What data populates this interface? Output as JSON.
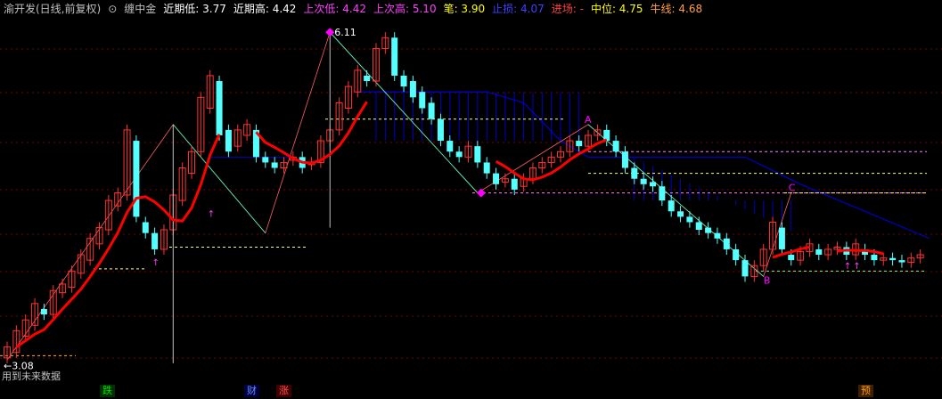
{
  "header": {
    "stock_title": "渝开发(日线,前复权)",
    "indicator_name": "缠中金",
    "recent_low": "近期低: 3.77",
    "recent_high": "近期高: 4.42",
    "prev_low": "上次低: 4.42",
    "prev_high": "上次高: 5.10",
    "stroke": "笔: 3.90",
    "stop_loss": "止损: 4.07",
    "entry": "进场: -",
    "midline": "中位: 4.75",
    "bull_line": "牛线: 4.68"
  },
  "colors": {
    "background": "#000000",
    "up_candle": "#ff3232",
    "down_candle": "#54ffff",
    "ma_line": "#ff0000",
    "zone": "#0000c8",
    "grid": "#780000",
    "pivot": "#ff00ff"
  },
  "annotations": {
    "high_label": "6.11",
    "low_label": "3.08",
    "pivot_a": "A",
    "pivot_b": "B",
    "pivot_c": "C",
    "footer_note": "用到未来数据"
  },
  "bottom_markers": [
    {
      "label": "跌",
      "color": "#00c000"
    },
    {
      "label": "财",
      "color": "#4080ff"
    },
    {
      "label": "涨",
      "color": "#ff4040"
    },
    {
      "label": "预",
      "color": "#ffa000"
    }
  ],
  "chart_data": {
    "type": "candlestick",
    "title": "渝开发(日线,前复权)",
    "price_range_visible": [
      3.08,
      6.11
    ],
    "bars": [
      {
        "o": 3.1,
        "c": 3.2
      },
      {
        "o": 3.15,
        "c": 3.35
      },
      {
        "o": 3.3,
        "c": 3.45
      },
      {
        "o": 3.4,
        "c": 3.6
      },
      {
        "o": 3.55,
        "c": 3.5
      },
      {
        "o": 3.5,
        "c": 3.72
      },
      {
        "o": 3.7,
        "c": 3.78
      },
      {
        "o": 3.75,
        "c": 3.9
      },
      {
        "o": 3.88,
        "c": 4.05
      },
      {
        "o": 4.0,
        "c": 4.2
      },
      {
        "o": 4.15,
        "c": 4.3
      },
      {
        "o": 4.28,
        "c": 4.55
      },
      {
        "o": 4.5,
        "c": 4.62
      },
      {
        "o": 4.6,
        "c": 5.2
      },
      {
        "o": 5.1,
        "c": 4.4
      },
      {
        "o": 4.35,
        "c": 4.25
      },
      {
        "o": 4.25,
        "c": 4.1
      },
      {
        "o": 4.1,
        "c": 4.28
      },
      {
        "o": 4.28,
        "c": 4.6
      },
      {
        "o": 4.55,
        "c": 4.85
      },
      {
        "o": 4.8,
        "c": 5.0
      },
      {
        "o": 5.0,
        "c": 5.5
      },
      {
        "o": 5.4,
        "c": 5.7
      },
      {
        "o": 5.65,
        "c": 5.15
      },
      {
        "o": 5.2,
        "c": 5.0
      },
      {
        "o": 5.05,
        "c": 5.2
      },
      {
        "o": 5.15,
        "c": 5.25
      },
      {
        "o": 5.2,
        "c": 4.95
      },
      {
        "o": 4.95,
        "c": 4.9
      },
      {
        "o": 4.9,
        "c": 4.85
      },
      {
        "o": 4.85,
        "c": 4.9
      },
      {
        "o": 4.92,
        "c": 4.95
      },
      {
        "o": 4.95,
        "c": 4.85
      },
      {
        "o": 4.88,
        "c": 4.9
      },
      {
        "o": 4.9,
        "c": 5.1
      },
      {
        "o": 5.1,
        "c": 5.2
      },
      {
        "o": 5.2,
        "c": 5.45
      },
      {
        "o": 5.4,
        "c": 5.6
      },
      {
        "o": 5.55,
        "c": 5.75
      },
      {
        "o": 5.7,
        "c": 5.65
      },
      {
        "o": 5.65,
        "c": 5.95
      },
      {
        "o": 5.95,
        "c": 6.05
      },
      {
        "o": 6.05,
        "c": 5.7
      },
      {
        "o": 5.7,
        "c": 5.6
      },
      {
        "o": 5.65,
        "c": 5.5
      },
      {
        "o": 5.55,
        "c": 5.4
      },
      {
        "o": 5.45,
        "c": 5.3
      },
      {
        "o": 5.3,
        "c": 5.1
      },
      {
        "o": 5.1,
        "c": 5.0
      },
      {
        "o": 5.0,
        "c": 4.95
      },
      {
        "o": 4.95,
        "c": 5.05
      },
      {
        "o": 5.05,
        "c": 4.9
      },
      {
        "o": 4.9,
        "c": 4.8
      },
      {
        "o": 4.8,
        "c": 4.7
      },
      {
        "o": 4.72,
        "c": 4.75
      },
      {
        "o": 4.75,
        "c": 4.65
      },
      {
        "o": 4.68,
        "c": 4.75
      },
      {
        "o": 4.75,
        "c": 4.85
      },
      {
        "o": 4.85,
        "c": 4.9
      },
      {
        "o": 4.9,
        "c": 4.95
      },
      {
        "o": 4.95,
        "c": 5.0
      },
      {
        "o": 5.0,
        "c": 5.1
      },
      {
        "o": 5.1,
        "c": 5.05
      },
      {
        "o": 5.05,
        "c": 5.15
      },
      {
        "o": 5.15,
        "c": 5.2
      },
      {
        "o": 5.2,
        "c": 5.1
      },
      {
        "o": 5.1,
        "c": 5.0
      },
      {
        "o": 5.0,
        "c": 4.85
      },
      {
        "o": 4.85,
        "c": 4.75
      },
      {
        "o": 4.75,
        "c": 4.7
      },
      {
        "o": 4.72,
        "c": 4.68
      },
      {
        "o": 4.68,
        "c": 4.55
      },
      {
        "o": 4.55,
        "c": 4.45
      },
      {
        "o": 4.45,
        "c": 4.4
      },
      {
        "o": 4.4,
        "c": 4.35
      },
      {
        "o": 4.35,
        "c": 4.28
      },
      {
        "o": 4.3,
        "c": 4.25
      },
      {
        "o": 4.25,
        "c": 4.2
      },
      {
        "o": 4.2,
        "c": 4.1
      },
      {
        "o": 4.1,
        "c": 4.0
      },
      {
        "o": 4.0,
        "c": 3.85
      },
      {
        "o": 3.85,
        "c": 3.95
      },
      {
        "o": 3.95,
        "c": 4.1
      },
      {
        "o": 4.1,
        "c": 4.35
      },
      {
        "o": 4.3,
        "c": 4.1
      },
      {
        "o": 4.05,
        "c": 4.0
      },
      {
        "o": 4.0,
        "c": 4.08
      },
      {
        "o": 4.08,
        "c": 4.15
      },
      {
        "o": 4.1,
        "c": 4.05
      },
      {
        "o": 4.05,
        "c": 4.1
      },
      {
        "o": 4.1,
        "c": 4.12
      },
      {
        "o": 4.12,
        "c": 4.05
      },
      {
        "o": 4.05,
        "c": 4.15
      },
      {
        "o": 4.1,
        "c": 4.05
      },
      {
        "o": 4.05,
        "c": 4.0
      },
      {
        "o": 4.0,
        "c": 4.02
      },
      {
        "o": 4.02,
        "c": 4.0
      },
      {
        "o": 4.0,
        "c": 3.98
      },
      {
        "o": 3.98,
        "c": 4.02
      },
      {
        "o": 4.02,
        "c": 4.05
      }
    ]
  }
}
